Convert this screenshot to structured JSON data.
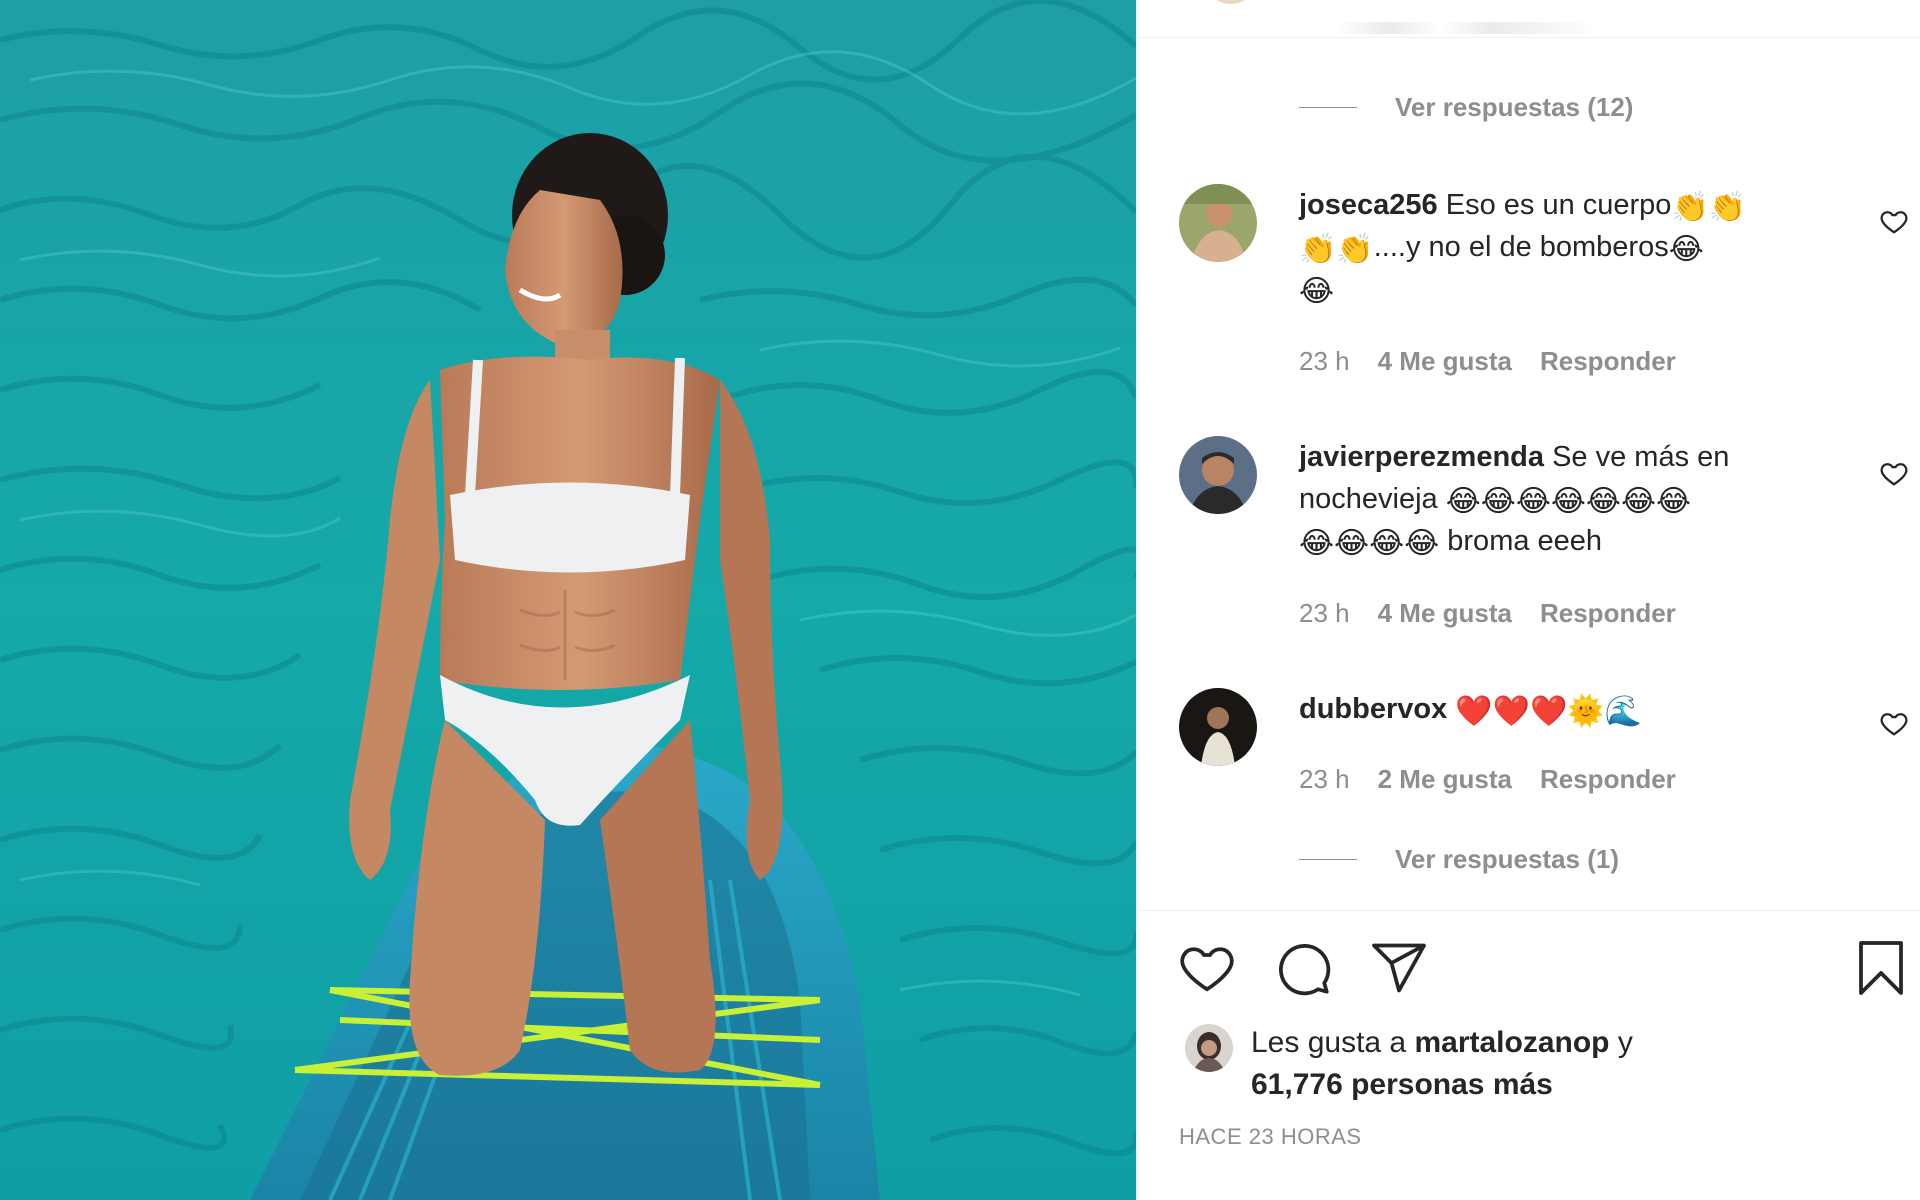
{
  "post": {
    "image_alt": "",
    "time_ago": "HACE 23 HORAS"
  },
  "comments": [
    {
      "replies_label_before": "Ver respuestas (12)",
      "username": "joseca256",
      "text_part1": " Eso es un cuerpo",
      "emoji_a": "👏👏",
      "emoji_b": "👏👏",
      "text_part2": "....y no el de bomberos",
      "emoji_c": "😂",
      "emoji_d": "😂",
      "time": "23 h",
      "likes": "4 Me gusta",
      "reply": "Responder"
    },
    {
      "username": "javierperezmenda",
      "text_part1": " Se ve más en nochevieja ",
      "emoji_a": "😂😂😂😂😂😂😂",
      "emoji_b": "😂😂😂😂",
      "text_part2": " broma eeeh",
      "time": "23 h",
      "likes": "4 Me gusta",
      "reply": "Responder"
    },
    {
      "username": "dubbervox",
      "emoji_a": "❤️❤️❤️🌞🌊",
      "time": "23 h",
      "likes": "2 Me gusta",
      "reply": "Responder",
      "replies_label_after": "Ver respuestas (1)"
    }
  ],
  "liked_by": {
    "prefix": "Les gusta a ",
    "user": "martalozanop",
    "suffix": " y",
    "count": "61,776 personas más"
  },
  "colors": {
    "text": "#262626",
    "muted": "#8e8e8e",
    "sea": "#1aa3a3"
  },
  "icons": [
    "like-icon",
    "comment-icon",
    "share-icon",
    "save-icon",
    "heart-outline-icon"
  ]
}
